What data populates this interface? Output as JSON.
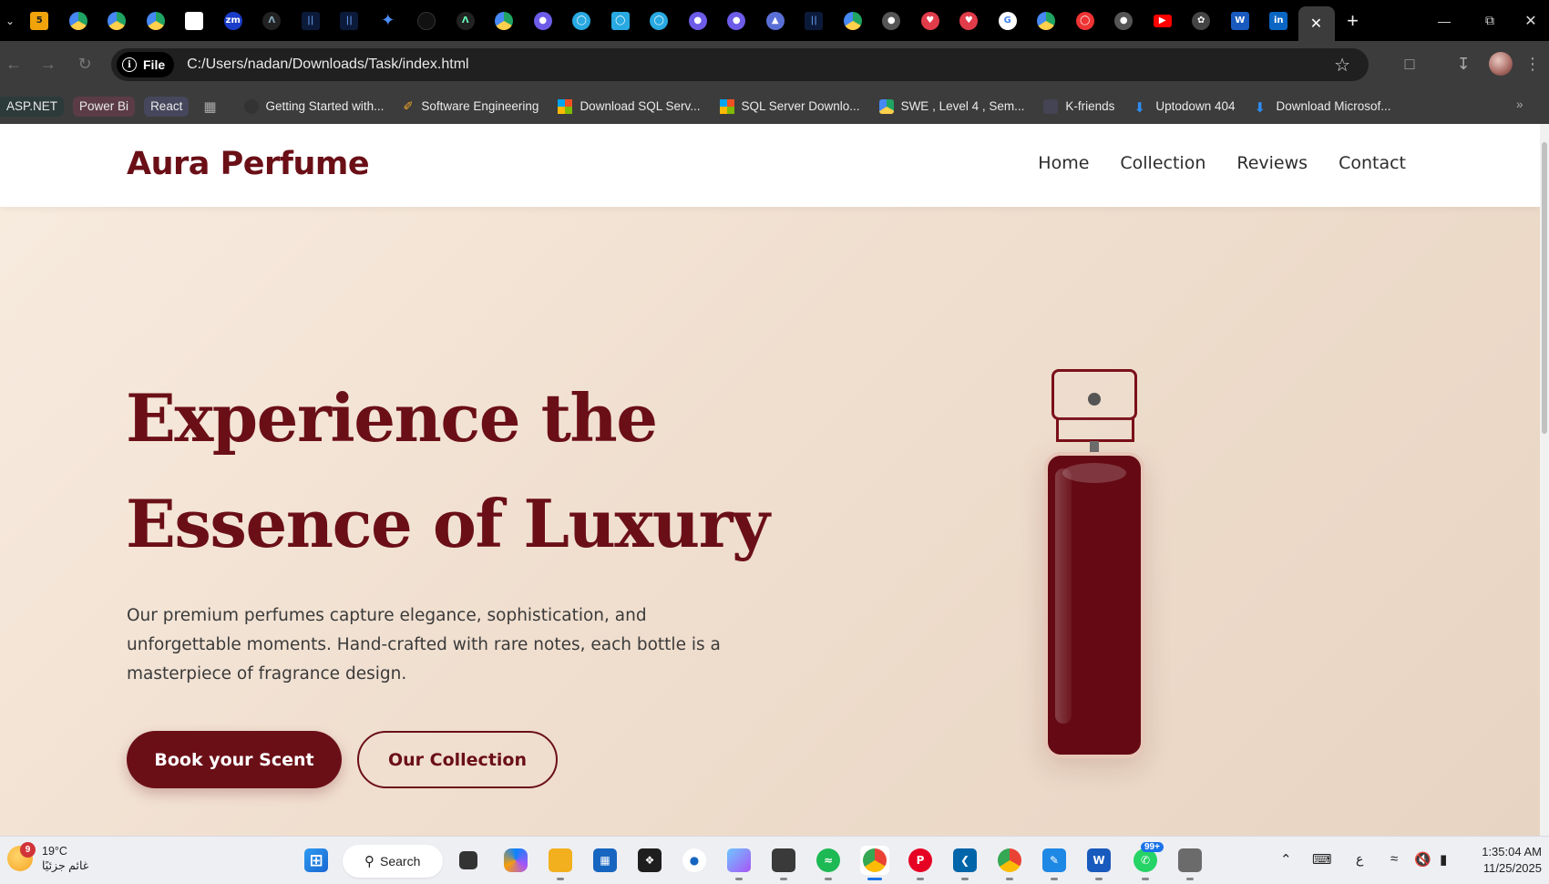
{
  "browser": {
    "tabs_count_visible": 33,
    "new_tab_label": "+",
    "url_scheme_label": "File",
    "url": "C:/Users/nadan/Downloads/Task/index.html",
    "bookmarks": {
      "tags": [
        "ASP.NET",
        "Power Bi",
        "React"
      ],
      "items": [
        "Getting Started with...",
        "Software Engineering",
        "Download SQL Serv...",
        "SQL Server Downlo...",
        "SWE , Level 4 , Sem...",
        "K-friends",
        "Uptodown 404",
        "Download Microsof..."
      ]
    }
  },
  "site": {
    "logo": "Aura Perfume",
    "nav": [
      "Home",
      "Collection",
      "Reviews",
      "Contact"
    ],
    "hero": {
      "title_line1": "Experience the",
      "title_line2": "Essence of Luxury",
      "text": "Our premium perfumes capture elegance, sophistication, and unforgettable moments. Hand-crafted with rare notes, each bottle is a masterpiece of fragrance design.",
      "primary_button": "Book your Scent",
      "secondary_button": "Our Collection"
    }
  },
  "taskbar": {
    "weather_badge": "9",
    "weather_temp": "19°C",
    "weather_desc": "غائم جزئيًا",
    "search_label": "Search",
    "whatsapp_badge": "99+",
    "lang_indicator": "ع",
    "time": "1:35:04 AM",
    "date": "11/25/2025"
  },
  "colors": {
    "brand": "#6b0f17",
    "hero_bg_start": "#f8ece0",
    "hero_bg_end": "#e8d4c2"
  }
}
